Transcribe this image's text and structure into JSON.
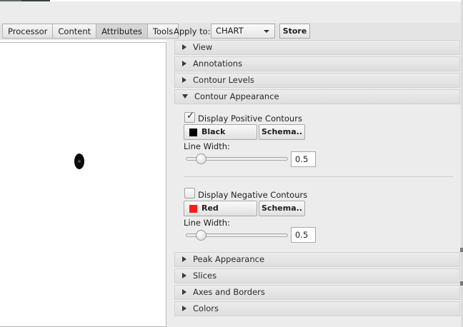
{
  "tabs": [
    {
      "label": "Processor",
      "active": false
    },
    {
      "label": "Content",
      "active": false
    },
    {
      "label": "Attributes",
      "active": true
    },
    {
      "label": "Tools",
      "active": false
    }
  ],
  "apply": {
    "label": "Apply to:",
    "selected": "CHART"
  },
  "store_label": "Store",
  "sections": {
    "view": "View",
    "annotations": "Annotations",
    "contour_levels": "Contour Levels",
    "contour_appearance": "Contour Appearance",
    "peak_appearance": "Peak Appearance",
    "slices": "Slices",
    "axes_borders": "Axes and Borders",
    "colors": "Colors"
  },
  "positive": {
    "label": "Display Positive Contours",
    "checked": true,
    "color_name": "Black",
    "color_hex": "#000000",
    "schema_label": "Schema..",
    "line_width_label": "Line Width:",
    "line_width": "0.5",
    "slider_fraction": 0.12
  },
  "negative": {
    "label": "Display Negative Contours",
    "checked": false,
    "color_name": "Red",
    "color_hex": "#ff1a1a",
    "schema_label": "Schema..",
    "line_width_label": "Line Width:",
    "line_width": "0.5",
    "slider_fraction": 0.12
  },
  "check_glyph": "✓"
}
